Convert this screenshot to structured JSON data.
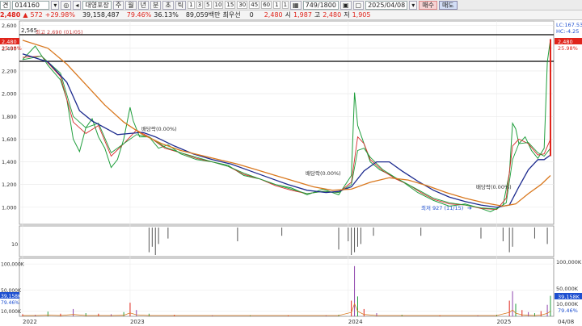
{
  "toolbar": {
    "mode_label": "견",
    "stock_code": "014160",
    "group_label": "대영포장",
    "period_buttons": [
      "주",
      "월",
      "년",
      "분",
      "초",
      "틱"
    ],
    "interval_buttons": [
      "1",
      "3",
      "5",
      "10",
      "15",
      "30",
      "45",
      "60",
      "1",
      "1"
    ],
    "count": "749",
    "total": "1800",
    "date": "2025/04/08",
    "buy_label": "매수",
    "sell_label": "매도"
  },
  "quote": {
    "price": "2,480",
    "change": "572",
    "change_pct": "+29.98%",
    "volume": "39,158,487",
    "ratio1": "79.46%",
    "ratio2": "36.13%",
    "turnover": "89,059백만",
    "preferred_label": "최우선",
    "preferred_value": "0",
    "last": "2,480",
    "open_label": "시",
    "open": "1,987",
    "high_label": "고",
    "high": "2,480",
    "low_label": "저",
    "low": "1,905"
  },
  "colors": {
    "up": "#e0241b",
    "down": "#1d4fd0",
    "ma_fast": "#d72a2a",
    "ma_mid": "#1f9e3c",
    "ma_slow": "#1c2a8e",
    "ma_long": "#d9781e"
  },
  "chart_data": [
    {
      "type": "line",
      "title": "",
      "x_ticks": [
        "2022",
        "2023",
        "2024",
        "2025",
        "04/08"
      ],
      "y_ticks": [
        1000,
        1200,
        1400,
        1600,
        1800,
        2000,
        2200,
        2400,
        2600
      ],
      "ylim": [
        850,
        2640
      ],
      "right_labels": [
        "LC:167.53",
        "HC:-4.25",
        "2,480",
        "25.98%"
      ],
      "left_labels": [
        "2,480",
        "25.98%"
      ],
      "top_value": "2,565",
      "annotations": [
        "최고 2,690 (01/05)",
        "배당락(0.00%)",
        "배당락(0.00%)",
        "배당락(0.00%)",
        "최저 927 (11/15)"
      ],
      "series": [
        {
          "key": "price",
          "values": [
            [
              0,
              2300
            ],
            [
              4,
              2420
            ],
            [
              8,
              2250
            ],
            [
              12,
              2120
            ],
            [
              14,
              1950
            ],
            [
              16,
              1600
            ],
            [
              18,
              1490
            ],
            [
              20,
              1700
            ],
            [
              22,
              1780
            ],
            [
              24,
              1620
            ],
            [
              26,
              1520
            ],
            [
              28,
              1350
            ],
            [
              30,
              1420
            ],
            [
              32,
              1600
            ],
            [
              34,
              1880
            ],
            [
              35,
              1760
            ],
            [
              37,
              1620
            ],
            [
              40,
              1620
            ],
            [
              43,
              1520
            ],
            [
              46,
              1550
            ],
            [
              50,
              1470
            ],
            [
              55,
              1420
            ],
            [
              60,
              1400
            ],
            [
              65,
              1370
            ],
            [
              70,
              1280
            ],
            [
              75,
              1250
            ],
            [
              80,
              1200
            ],
            [
              85,
              1170
            ],
            [
              90,
              1110
            ],
            [
              95,
              1160
            ],
            [
              100,
              1110
            ],
            [
              104,
              1280
            ],
            [
              105,
              2010
            ],
            [
              106,
              1720
            ],
            [
              108,
              1560
            ],
            [
              110,
              1400
            ],
            [
              113,
              1330
            ],
            [
              116,
              1290
            ],
            [
              120,
              1230
            ],
            [
              125,
              1130
            ],
            [
              130,
              1060
            ],
            [
              135,
              1010
            ],
            [
              140,
              1030
            ],
            [
              145,
              990
            ],
            [
              148,
              960
            ],
            [
              150,
              990
            ],
            [
              152,
              1020
            ],
            [
              154,
              1300
            ],
            [
              155,
              1740
            ],
            [
              156,
              1690
            ],
            [
              157,
              1560
            ],
            [
              159,
              1620
            ],
            [
              161,
              1500
            ],
            [
              163,
              1430
            ],
            [
              165,
              1520
            ],
            [
              166,
              2280
            ],
            [
              167,
              2480
            ]
          ]
        },
        {
          "key": "ma_fast",
          "values": [
            [
              0,
              2320
            ],
            [
              6,
              2330
            ],
            [
              12,
              2150
            ],
            [
              16,
              1750
            ],
            [
              20,
              1650
            ],
            [
              24,
              1720
            ],
            [
              28,
              1450
            ],
            [
              32,
              1560
            ],
            [
              36,
              1680
            ],
            [
              40,
              1620
            ],
            [
              45,
              1520
            ],
            [
              50,
              1480
            ],
            [
              55,
              1430
            ],
            [
              60,
              1400
            ],
            [
              65,
              1360
            ],
            [
              70,
              1290
            ],
            [
              75,
              1250
            ],
            [
              80,
              1190
            ],
            [
              85,
              1150
            ],
            [
              90,
              1120
            ],
            [
              95,
              1140
            ],
            [
              100,
              1130
            ],
            [
              104,
              1220
            ],
            [
              106,
              1620
            ],
            [
              108,
              1560
            ],
            [
              110,
              1420
            ],
            [
              114,
              1320
            ],
            [
              118,
              1250
            ],
            [
              122,
              1200
            ],
            [
              126,
              1130
            ],
            [
              130,
              1070
            ],
            [
              135,
              1030
            ],
            [
              140,
              1020
            ],
            [
              145,
              990
            ],
            [
              150,
              980
            ],
            [
              153,
              1080
            ],
            [
              155,
              1540
            ],
            [
              157,
              1600
            ],
            [
              160,
              1560
            ],
            [
              163,
              1460
            ],
            [
              165,
              1470
            ],
            [
              167,
              1600
            ]
          ]
        },
        {
          "key": "ma_mid",
          "values": [
            [
              0,
              2300
            ],
            [
              6,
              2330
            ],
            [
              12,
              2180
            ],
            [
              16,
              1800
            ],
            [
              20,
              1700
            ],
            [
              24,
              1740
            ],
            [
              28,
              1480
            ],
            [
              32,
              1560
            ],
            [
              36,
              1640
            ],
            [
              40,
              1620
            ],
            [
              45,
              1530
            ],
            [
              50,
              1480
            ],
            [
              55,
              1440
            ],
            [
              60,
              1400
            ],
            [
              65,
              1360
            ],
            [
              70,
              1300
            ],
            [
              75,
              1250
            ],
            [
              80,
              1200
            ],
            [
              85,
              1160
            ],
            [
              90,
              1120
            ],
            [
              95,
              1140
            ],
            [
              100,
              1130
            ],
            [
              104,
              1200
            ],
            [
              106,
              1500
            ],
            [
              108,
              1520
            ],
            [
              110,
              1440
            ],
            [
              114,
              1330
            ],
            [
              118,
              1260
            ],
            [
              122,
              1200
            ],
            [
              126,
              1140
            ],
            [
              130,
              1080
            ],
            [
              135,
              1040
            ],
            [
              140,
              1020
            ],
            [
              145,
              995
            ],
            [
              150,
              985
            ],
            [
              153,
              1040
            ],
            [
              155,
              1420
            ],
            [
              157,
              1560
            ],
            [
              160,
              1570
            ],
            [
              163,
              1480
            ],
            [
              165,
              1450
            ],
            [
              167,
              1520
            ]
          ]
        },
        {
          "key": "ma_slow",
          "values": [
            [
              0,
              2350
            ],
            [
              8,
              2280
            ],
            [
              14,
              2100
            ],
            [
              18,
              1850
            ],
            [
              22,
              1760
            ],
            [
              26,
              1700
            ],
            [
              30,
              1640
            ],
            [
              34,
              1650
            ],
            [
              38,
              1660
            ],
            [
              42,
              1620
            ],
            [
              48,
              1540
            ],
            [
              54,
              1470
            ],
            [
              60,
              1420
            ],
            [
              66,
              1380
            ],
            [
              72,
              1320
            ],
            [
              78,
              1260
            ],
            [
              84,
              1200
            ],
            [
              90,
              1150
            ],
            [
              96,
              1130
            ],
            [
              100,
              1140
            ],
            [
              104,
              1180
            ],
            [
              108,
              1320
            ],
            [
              112,
              1400
            ],
            [
              116,
              1400
            ],
            [
              120,
              1320
            ],
            [
              125,
              1230
            ],
            [
              130,
              1150
            ],
            [
              135,
              1090
            ],
            [
              140,
              1050
            ],
            [
              145,
              1020
            ],
            [
              150,
              1000
            ],
            [
              154,
              1020
            ],
            [
              157,
              1180
            ],
            [
              160,
              1330
            ],
            [
              163,
              1420
            ],
            [
              165,
              1420
            ],
            [
              167,
              1460
            ]
          ]
        },
        {
          "key": "ma_long",
          "values": [
            [
              0,
              2470
            ],
            [
              8,
              2400
            ],
            [
              14,
              2260
            ],
            [
              20,
              2080
            ],
            [
              26,
              1900
            ],
            [
              32,
              1750
            ],
            [
              38,
              1640
            ],
            [
              44,
              1560
            ],
            [
              50,
              1500
            ],
            [
              56,
              1460
            ],
            [
              62,
              1420
            ],
            [
              68,
              1380
            ],
            [
              74,
              1330
            ],
            [
              80,
              1280
            ],
            [
              86,
              1230
            ],
            [
              92,
              1180
            ],
            [
              98,
              1150
            ],
            [
              104,
              1160
            ],
            [
              110,
              1220
            ],
            [
              116,
              1260
            ],
            [
              122,
              1240
            ],
            [
              128,
              1190
            ],
            [
              134,
              1130
            ],
            [
              140,
              1080
            ],
            [
              146,
              1040
            ],
            [
              152,
              1010
            ],
            [
              156,
              1030
            ],
            [
              160,
              1120
            ],
            [
              164,
              1200
            ],
            [
              167,
              1280
            ]
          ]
        }
      ],
      "n_points": 168
    },
    {
      "type": "bar",
      "title": "",
      "y_ticks": [
        10
      ],
      "bars": [
        [
          40,
          0.9
        ],
        [
          41,
          0.7
        ],
        [
          42,
          1.0
        ],
        [
          43,
          0.6
        ],
        [
          46,
          0.4
        ],
        [
          68,
          0.5
        ],
        [
          82,
          0.3
        ],
        [
          100,
          0.8
        ],
        [
          103,
          0.5
        ],
        [
          104,
          1.0
        ],
        [
          105,
          0.9
        ],
        [
          106,
          0.7
        ],
        [
          107,
          0.6
        ],
        [
          111,
          0.3
        ],
        [
          126,
          0.3
        ],
        [
          145,
          0.4
        ],
        [
          152,
          0.5
        ],
        [
          154,
          0.9
        ],
        [
          155,
          0.7
        ],
        [
          162,
          0.4
        ],
        [
          166,
          0.6
        ]
      ]
    },
    {
      "type": "bar",
      "title": "",
      "y_ticks": [
        10000000,
        50000000,
        100000000
      ],
      "y_tick_labels": [
        "10,000K",
        "50,000K",
        "100,000K"
      ],
      "right_labels": [
        "100,000K",
        "50,000K",
        "39,158K",
        "10,000K",
        "79.46%"
      ],
      "left_labels": [
        "39,158K",
        "79.46%"
      ],
      "ylim": [
        0,
        108000000
      ],
      "bars": [
        [
          0,
          4000000
        ],
        [
          4,
          3000000
        ],
        [
          8,
          9000000
        ],
        [
          12,
          5000000
        ],
        [
          16,
          14000000
        ],
        [
          20,
          6000000
        ],
        [
          24,
          5000000
        ],
        [
          28,
          4000000
        ],
        [
          32,
          8000000
        ],
        [
          34,
          26000000
        ],
        [
          36,
          12000000
        ],
        [
          40,
          5000000
        ],
        [
          48,
          3000000
        ],
        [
          60,
          2000000
        ],
        [
          72,
          2000000
        ],
        [
          84,
          2000000
        ],
        [
          96,
          2000000
        ],
        [
          100,
          3000000
        ],
        [
          104,
          30000000
        ],
        [
          105,
          96000000
        ],
        [
          106,
          38000000
        ],
        [
          108,
          14000000
        ],
        [
          112,
          6000000
        ],
        [
          120,
          3000000
        ],
        [
          132,
          2000000
        ],
        [
          144,
          2000000
        ],
        [
          150,
          3000000
        ],
        [
          154,
          30000000
        ],
        [
          155,
          48000000
        ],
        [
          156,
          24000000
        ],
        [
          158,
          12000000
        ],
        [
          160,
          8000000
        ],
        [
          162,
          6000000
        ],
        [
          164,
          10000000
        ],
        [
          166,
          22000000
        ],
        [
          167,
          39158000
        ]
      ]
    }
  ]
}
